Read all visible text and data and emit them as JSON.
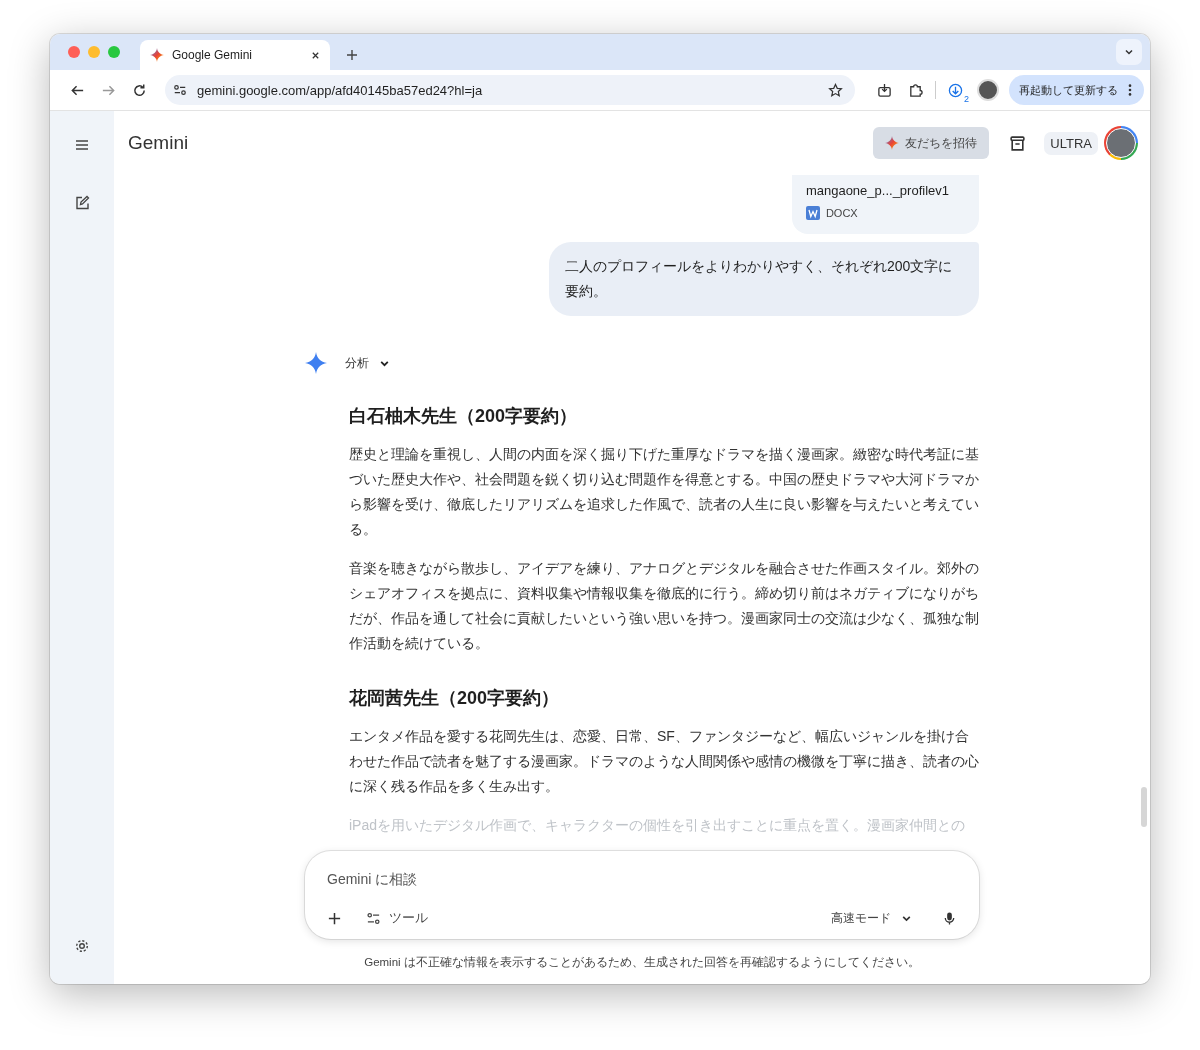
{
  "browser": {
    "tabs": [
      {
        "title": "Google Gemini",
        "selected": true
      }
    ],
    "url": "gemini.google.com/app/afd40145ba57ed24?hl=ja",
    "download_count": "2",
    "update_button": "再起動して更新する"
  },
  "header": {
    "title": "Gemini",
    "invite_button": "友だちを招待",
    "plan_badge": "ULTRA"
  },
  "conversation": {
    "attachment": {
      "name": "mangaone_p..._profilev1",
      "type": "DOCX"
    },
    "user_message": "二人のプロフィールをよりわかりやすく、それぞれ200文字に要約。",
    "response": {
      "thinking_label": "分析",
      "blocks": [
        {
          "kind": "heading",
          "text": "白石柚木先生（200字要約）"
        },
        {
          "kind": "paragraph",
          "text": "歴史と理論を重視し、人間の内面を深く掘り下げた重厚なドラマを描く漫画家。緻密な時代考証に基づいた歴史大作や、社会問題を鋭く切り込む問題作を得意とする。中国の歴史ドラマや大河ドラマから影響を受け、徹底したリアリズムを追求した作風で、読者の人生に良い影響を与えたいと考えている。"
        },
        {
          "kind": "paragraph",
          "text": "音楽を聴きながら散歩し、アイデアを練り、アナログとデジタルを融合させた作画スタイル。郊外のシェアオフィスを拠点に、資料収集や情報収集を徹底的に行う。締め切り前はネガティブになりがちだが、作品を通して社会に貢献したいという強い思いを持つ。漫画家同士の交流は少なく、孤独な制作活動を続けている。"
        },
        {
          "kind": "heading",
          "text": "花岡茜先生（200字要約）"
        },
        {
          "kind": "paragraph",
          "text": "エンタメ作品を愛する花岡先生は、恋愛、日常、SF、ファンタジーなど、幅広いジャンルを掛け合わせた作品で読者を魅了する漫画家。ドラマのような人間関係や感情の機微を丁寧に描き、読者の心に深く残る作品を多く生み出す。"
        },
        {
          "kind": "faded",
          "text": "iPadを用いたデジタル作画で、キャラクターの個性を引き出すことに重点を置く。漫画家仲間との"
        }
      ]
    }
  },
  "composer": {
    "placeholder": "Gemini に相談",
    "tools_label": "ツール",
    "mode_label": "高速モード"
  },
  "disclaimer": "Gemini は不正確な情報を表示することがあるため、生成された回答を再確認するようにしてください。"
}
